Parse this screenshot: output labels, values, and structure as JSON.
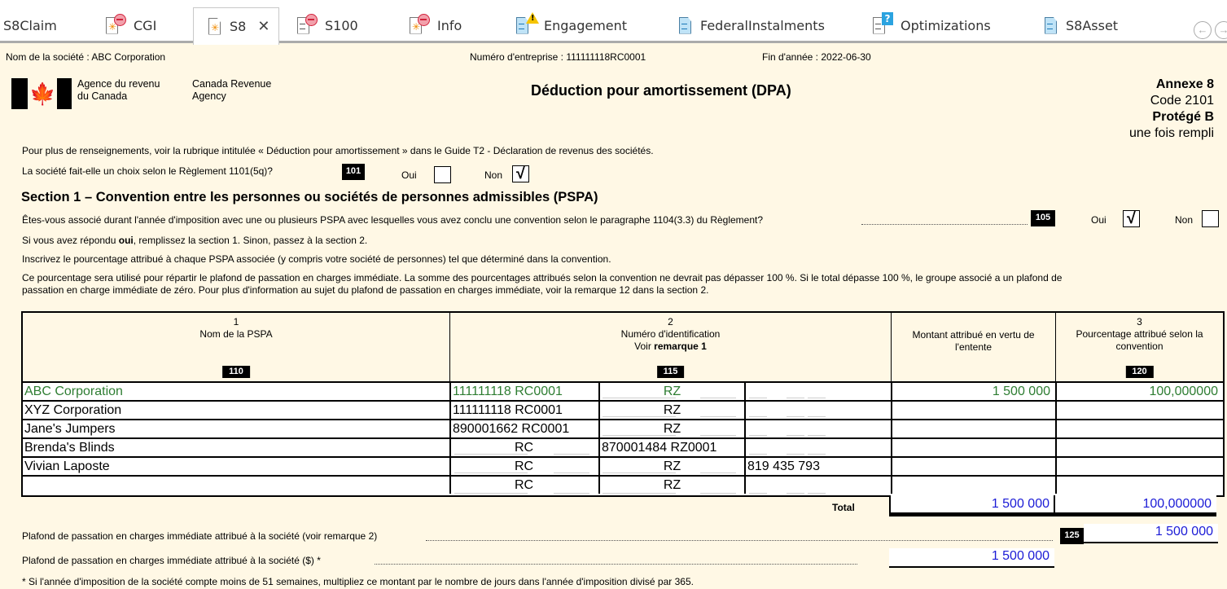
{
  "tabs": [
    {
      "label": "S8Claim",
      "icon": "none",
      "active": false
    },
    {
      "label": "CGI",
      "icon": "doc-star-error-icon",
      "active": false
    },
    {
      "label": "S8",
      "icon": "doc-star-icon",
      "active": true,
      "close": "✕"
    },
    {
      "label": "S100",
      "icon": "doc-lines-error-icon",
      "active": false
    },
    {
      "label": "Info",
      "icon": "doc-star-error-icon",
      "active": false
    },
    {
      "label": "Engagement",
      "icon": "doc-blue-warning-icon",
      "active": false
    },
    {
      "label": "FederalInstalments",
      "icon": "doc-blue-icon",
      "active": false
    },
    {
      "label": "Optimizations",
      "icon": "doc-lines-question-icon",
      "active": false
    },
    {
      "label": "S8Asset",
      "icon": "doc-blue-icon",
      "active": false
    }
  ],
  "nav": {
    "prev": "←",
    "next": "→"
  },
  "header": {
    "company": "Nom de la société : ABC Corporation",
    "business_number": "Numéro d'entreprise : 111111118RC0001",
    "year_end": "Fin d'année : 2022-06-30",
    "agency_fr_1": "Agence du revenu",
    "agency_fr_2": "du Canada",
    "agency_en_1": "Canada Revenue",
    "agency_en_2": "Agency",
    "title": "Déduction pour amortissement (DPA)",
    "annex": "Annexe 8",
    "code": "Code 2101",
    "protected": "Protégé B",
    "once_filled": "une fois rempli"
  },
  "intro": {
    "info": "Pour plus de renseignements, voir la rubrique intitulée « Déduction pour amortissement » dans le Guide T2 - Déclaration de revenus des sociétés.",
    "q101": "La société fait-elle un choix selon le Règlement 1101(5q)?",
    "code101": "101",
    "oui": "Oui",
    "non": "Non",
    "q101_oui_checked": false,
    "q101_non_checked": true
  },
  "section1": {
    "title": "Section 1 – Convention entre les personnes ou sociétés de personnes admissibles (PSPA)",
    "q105": "Êtes-vous associé durant l'année d'imposition avec une ou plusieurs PSPA avec lesquelles vous avez conclu une convention selon le paragraphe 1104(3.3) du Règlement?",
    "code105": "105",
    "oui": "Oui",
    "non": "Non",
    "q105_oui_checked": true,
    "q105_non_checked": false,
    "check_mark": "√",
    "line1_pre": "Si vous avez répondu ",
    "line1_bold": "oui",
    "line1_post": ", remplissez la section 1. Sinon, passez à la section 2.",
    "line2": "Inscrivez le pourcentage attribué à chaque PSPA associée (y compris votre société de personnes) tel que déterminé dans la convention.",
    "line3a": "Ce pourcentage sera utilisé pour répartir le plafond de passation en charges immédiate. La somme des pourcentages attribués selon la convention ne devrait pas dépasser 100 %. Si le total dépasse 100 %, le groupe associé a un plafond de",
    "line3b": "passation en charge immédiate de zéro. Pour plus d'information au sujet du plafond de passation en charges immédiate, voir la remarque 12 dans la section 2."
  },
  "table": {
    "headers": {
      "c1_num": "1",
      "c1_label": "Nom de la PSPA",
      "c1_code": "110",
      "c2_num": "2",
      "c2_label": "Numéro d'identification",
      "c2_sub_pre": "Voir ",
      "c2_sub_bold": "remarque 1",
      "c2_code": "115",
      "c3_label": "Montant attribué en vertu de l'entente",
      "c4_num": "3",
      "c4_label": "Pourcentage attribué selon la convention",
      "c4_code": "120"
    },
    "rows": [
      {
        "name": "ABC Corporation",
        "id_rc": "111111118 RC0001",
        "id_rz": "RZ",
        "id_other": "",
        "amount": "1 500 000",
        "percent": "100,000000",
        "highlight": true
      },
      {
        "name": "XYZ Corporation",
        "id_rc": "111111118 RC0001",
        "id_rz": "RZ",
        "id_other": "",
        "amount": "",
        "percent": "",
        "highlight": false
      },
      {
        "name": "Jane's Jumpers",
        "id_rc": "890001662 RC0001",
        "id_rz": "RZ",
        "id_other": "",
        "amount": "",
        "percent": "",
        "highlight": false
      },
      {
        "name": "Brenda's Blinds",
        "id_rc": "RC",
        "id_rz": "870001484 RZ0001",
        "id_other": "",
        "amount": "",
        "percent": "",
        "highlight": false
      },
      {
        "name": "Vivian Laposte",
        "id_rc": "RC",
        "id_rz": "RZ",
        "id_other": "819 435 793",
        "amount": "",
        "percent": "",
        "highlight": false
      },
      {
        "name": "",
        "id_rc": "RC",
        "id_rz": "RZ",
        "id_other": "",
        "amount": "",
        "percent": "",
        "highlight": false
      }
    ],
    "total_label": "Total",
    "total_amount": "1 500 000",
    "total_percent": "100,000000"
  },
  "footer": {
    "limit_label": "Plafond de passation en charges immédiate attribué à la société (voir remarque 2)",
    "code125": "125",
    "limit_value": "1 500 000",
    "limit_dollar_label": "Plafond de passation en charges immédiate attribué à la société ($) *",
    "limit_dollar_value": "1 500 000",
    "note": "* Si l'année d'imposition de la société compte moins de 51 semaines, multipliez ce montant par le nombre de jours dans l'année d'imposition divisé par 365."
  }
}
